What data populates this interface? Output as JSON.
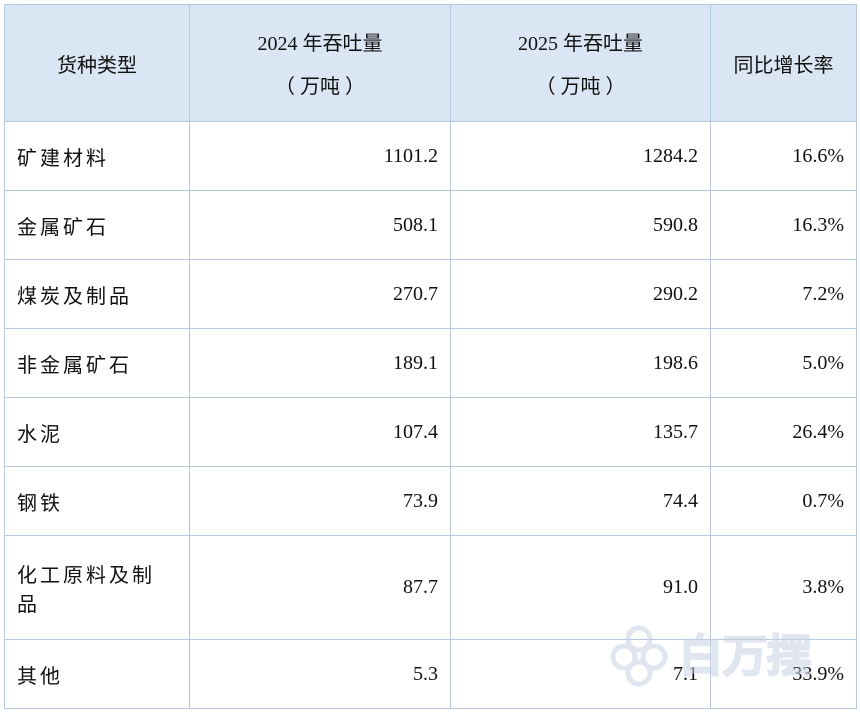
{
  "table": {
    "headers": {
      "type": "货种类型",
      "y2024_title": "2024 年吞吐量",
      "y2024_unit": "（ 万吨 ）",
      "y2025_title": "2025 年吞吐量",
      "y2025_unit": "（ 万吨 ）",
      "growth": "同比增长率"
    },
    "rows": [
      {
        "name": "矿建材料",
        "y2024": "1101.2",
        "y2025": "1284.2",
        "growth": "16.6%"
      },
      {
        "name": "金属矿石",
        "y2024": "508.1",
        "y2025": "590.8",
        "growth": "16.3%"
      },
      {
        "name": "煤炭及制品",
        "y2024": "270.7",
        "y2025": "290.2",
        "growth": "7.2%"
      },
      {
        "name": "非金属矿石",
        "y2024": "189.1",
        "y2025": "198.6",
        "growth": "5.0%"
      },
      {
        "name": "水泥",
        "y2024": "107.4",
        "y2025": "135.7",
        "growth": "26.4%"
      },
      {
        "name": "钢铁",
        "y2024": "73.9",
        "y2025": "74.4",
        "growth": "0.7%"
      },
      {
        "name": "化工原料及制品",
        "y2024": "87.7",
        "y2025": "91.0",
        "growth": "3.8%"
      },
      {
        "name": "其他",
        "y2024": "5.3",
        "y2025": "7.1",
        "growth": "33.9%"
      }
    ]
  },
  "watermark": {
    "text": "白万摆",
    "color": "#c7d3e3"
  }
}
